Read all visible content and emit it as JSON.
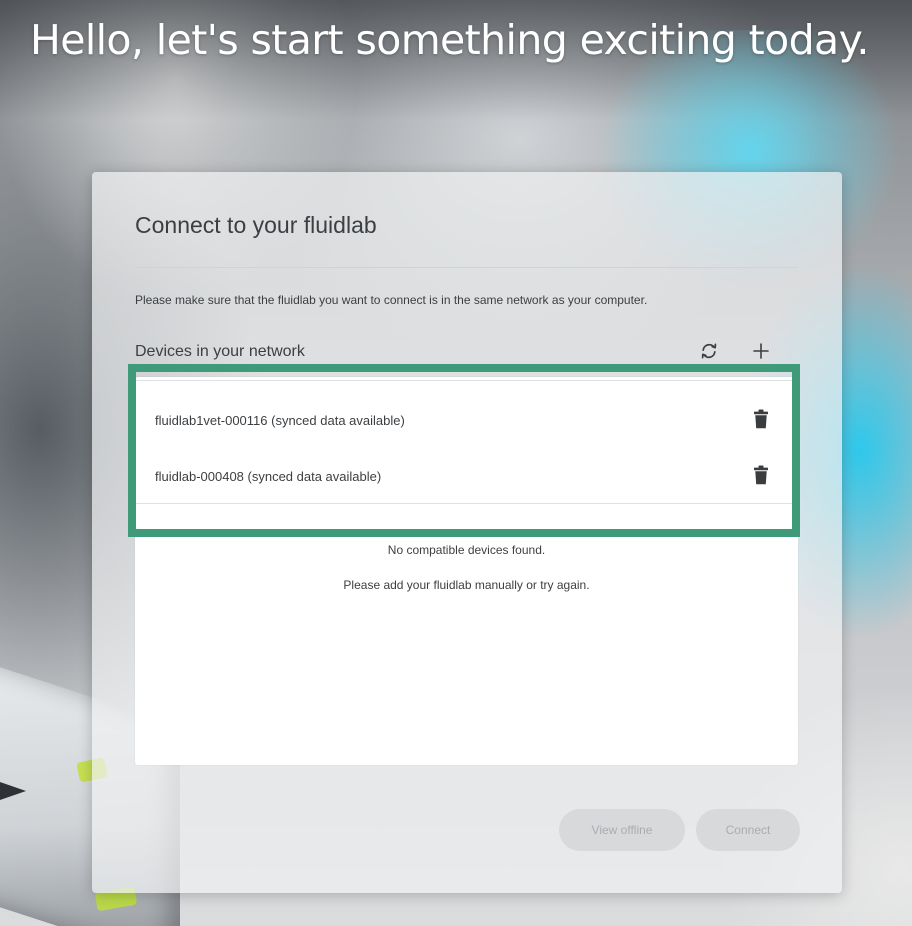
{
  "headline": "Hello, let's start something exciting today.",
  "dialog": {
    "title": "Connect to your fluidlab",
    "info": "Please make sure that the fluidlab you want to connect is in the same network as your computer.",
    "devices_label": "Devices in your network",
    "toolbar_icons": [
      "refresh-icon",
      "plus-icon"
    ],
    "devices": [
      {
        "name": "fluidlab1vet-000116 (synced data available)",
        "icon": "trash-icon"
      },
      {
        "name": "fluidlab-000408 (synced data available)",
        "icon": "trash-icon"
      }
    ],
    "empty_message": "No compatible devices found.",
    "empty_hint": "Please add your fluidlab manually or try again.",
    "buttons": {
      "view_offline": "View offline",
      "connect": "Connect"
    }
  },
  "colors": {
    "highlight_border": "#3f9a7a",
    "disabled_button_bg": "#d7d9db",
    "disabled_button_text": "#a9adb1",
    "text": "#3c3f42"
  }
}
